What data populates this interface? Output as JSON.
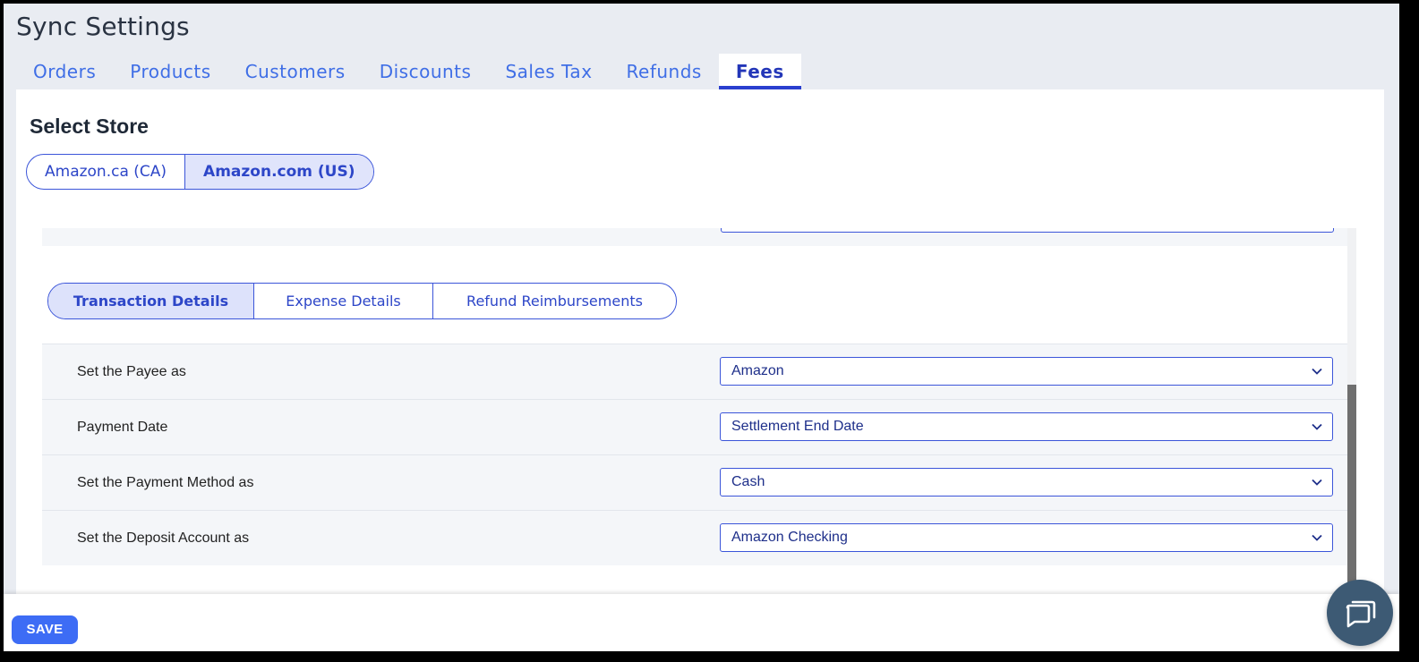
{
  "page": {
    "title": "Sync Settings"
  },
  "tabs": [
    {
      "label": "Orders"
    },
    {
      "label": "Products"
    },
    {
      "label": "Customers"
    },
    {
      "label": "Discounts"
    },
    {
      "label": "Sales Tax"
    },
    {
      "label": "Refunds"
    },
    {
      "label": "Fees",
      "active": true
    }
  ],
  "store": {
    "heading": "Select Store",
    "options": [
      {
        "label": "Amazon.ca (CA)"
      },
      {
        "label": "Amazon.com (US)",
        "selected": true
      }
    ]
  },
  "subtabs": [
    {
      "label": "Transaction Details",
      "selected": true
    },
    {
      "label": "Expense Details"
    },
    {
      "label": "Refund Reimbursements"
    }
  ],
  "settings": [
    {
      "label": "Set the Payee as",
      "value": "Amazon"
    },
    {
      "label": "Payment Date",
      "value": "Settlement End Date"
    },
    {
      "label": "Set the Payment Method as",
      "value": "Cash"
    },
    {
      "label": "Set the Deposit Account as",
      "value": "Amazon Checking"
    }
  ],
  "footer": {
    "save_label": "SAVE"
  },
  "icons": {
    "dropdown": "chevron-down-icon",
    "chat": "chat-icon"
  },
  "colors": {
    "accent": "#3d6cf5",
    "border": "#3b55d9",
    "chat": "#3d5a74",
    "active_tab": "#2336b8"
  }
}
